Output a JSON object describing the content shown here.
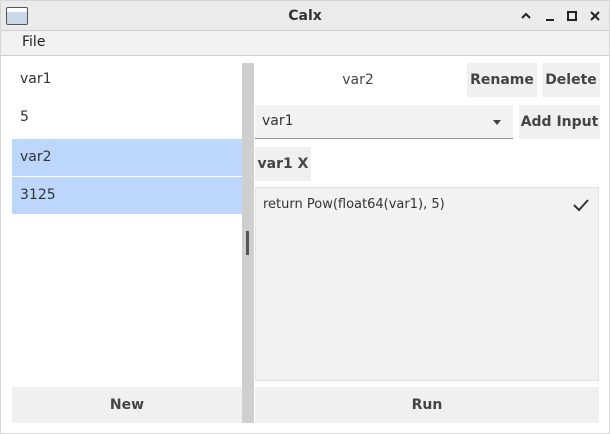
{
  "window": {
    "title": "Calx",
    "buttons": {
      "restore_icon": "chevron-up-icon",
      "minimize_icon": "minimize-icon",
      "maximize_icon": "maximize-icon",
      "close_icon": "close-icon"
    }
  },
  "menu": {
    "file": "File"
  },
  "variables": [
    {
      "name": "var1",
      "value": "5",
      "selected": false
    },
    {
      "name": "var2",
      "value": "3125",
      "selected": true
    }
  ],
  "sidebar": {
    "new_button": "New"
  },
  "editor": {
    "name": "var2",
    "rename_button": "Rename",
    "delete_button": "Delete",
    "input_select": "var1",
    "add_input_button": "Add Input",
    "input_tag": "var1 X",
    "code": "return Pow(float64(var1), 5)",
    "run_button": "Run"
  },
  "colors": {
    "selection": "#bcd7fb",
    "button_bg": "#f0f0f0"
  }
}
